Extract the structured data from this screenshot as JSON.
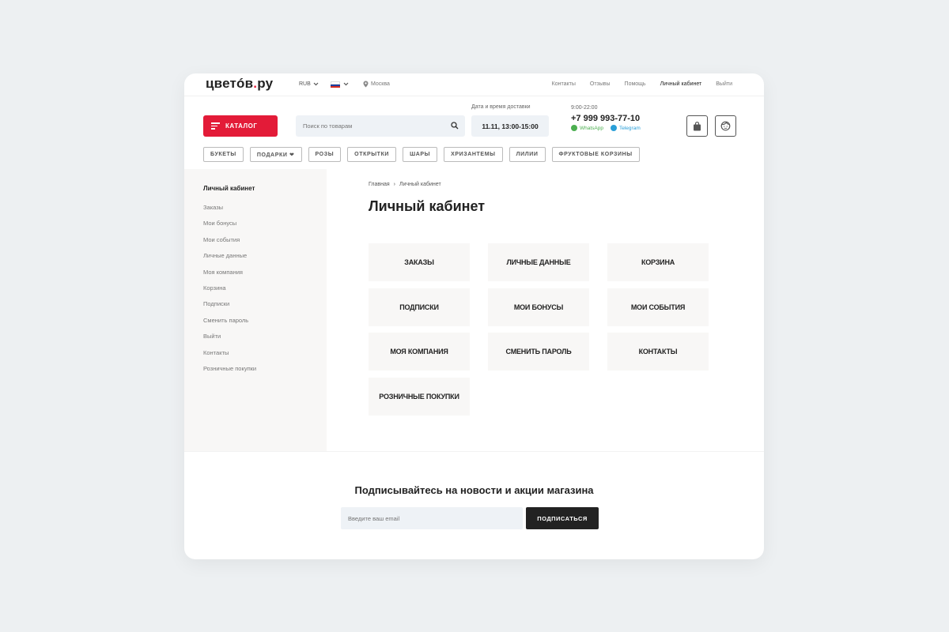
{
  "topbar": {
    "logo_main": "цветóв",
    "logo_dot": ".",
    "logo_tail": "ру",
    "currency": "RUB",
    "city": "Москва",
    "links": [
      "Контакты",
      "Отзывы",
      "Помощь",
      "Личный кабинет",
      "Выйти"
    ],
    "active_link": "Личный кабинет"
  },
  "header": {
    "catalog_label": "КАТАЛОГ",
    "search_placeholder": "Поиск по товарам",
    "delivery_label": "Дата и время доставки",
    "delivery_value": "11.11, 13:00-15:00",
    "hours": "9:00-22:00",
    "phone": "+7 999 993-77-10",
    "whatsapp": "WhatsApp",
    "telegram": "Telegram"
  },
  "categories": [
    "БУКЕТЫ",
    "ПОДАРКИ ❤",
    "РОЗЫ",
    "ОТКРЫТКИ",
    "ШАРЫ",
    "ХРИЗАНТЕМЫ",
    "ЛИЛИИ",
    "ФРУКТОВЫЕ КОРЗИНЫ"
  ],
  "sidebar": {
    "title": "Личный кабинет",
    "items": [
      "Заказы",
      "Мои бонусы",
      "Мои события",
      "Личные данные",
      "Моя компания",
      "Корзина",
      "Подписки",
      "Сменить пароль",
      "Выйти",
      "Контакты",
      "Розничные покупки"
    ]
  },
  "main": {
    "breadcrumb": [
      "Главная",
      "›",
      "Личный кабинет"
    ],
    "title": "Личный кабинет",
    "tiles": [
      "ЗАКАЗЫ",
      "ЛИЧНЫЕ ДАННЫЕ",
      "КОРЗИНА",
      "ПОДПИСКИ",
      "МОИ БОНУСЫ",
      "МОИ СОБЫТИЯ",
      "МОЯ КОМПАНИЯ",
      "СМЕНИТЬ ПАРОЛЬ",
      "КОНТАКТЫ",
      "РОЗНИЧНЫЕ ПОКУПКИ"
    ]
  },
  "subscribe": {
    "title": "Подписывайтесь на новости и акции магазина",
    "placeholder": "Введите ваш email",
    "button": "ПОДПИСАТЬСЯ"
  },
  "colors": {
    "accent": "#e31b38",
    "dark": "#222222",
    "tile_bg": "#f8f7f6",
    "input_bg": "#eef2f6"
  }
}
